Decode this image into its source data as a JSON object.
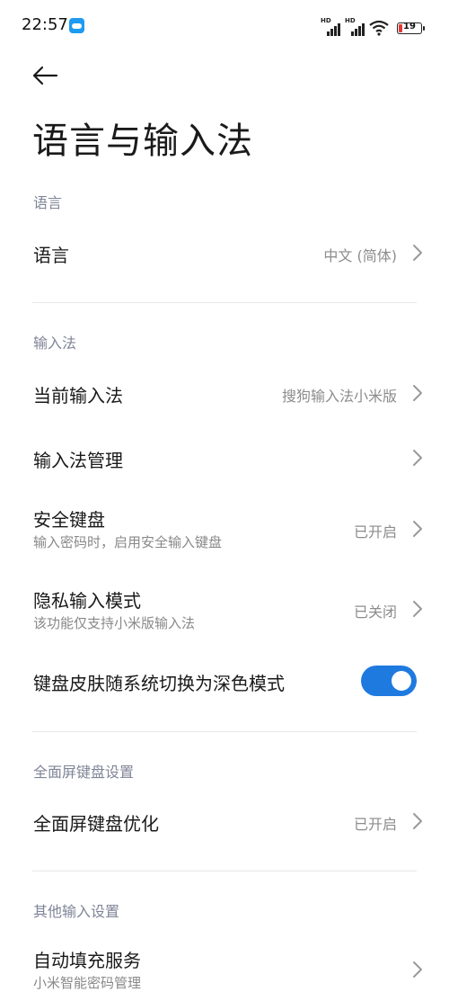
{
  "status_bar": {
    "time": "22:57",
    "app_icon": "cloud-app-icon",
    "signal_1_label": "HD",
    "signal_2_label": "HD",
    "battery_level": "19",
    "battery_color": "#e53935"
  },
  "header": {
    "back_icon": "arrow-left-icon",
    "title": "语言与输入法"
  },
  "sections": {
    "language": {
      "header": "语言",
      "items": [
        {
          "title": "语言",
          "value": "中文 (简体)"
        }
      ]
    },
    "input_method": {
      "header": "输入法",
      "items": [
        {
          "title": "当前输入法",
          "value": "搜狗输入法小米版"
        },
        {
          "title": "输入法管理",
          "value": ""
        },
        {
          "title": "安全键盘",
          "subtitle": "输入密码时，启用安全输入键盘",
          "value": "已开启"
        },
        {
          "title": "隐私输入模式",
          "subtitle": "该功能仅支持小米版输入法",
          "value": "已关闭"
        },
        {
          "title": "键盘皮肤随系统切换为深色模式",
          "toggle_on": true
        }
      ]
    },
    "fullscreen_keyboard": {
      "header": "全面屏键盘设置",
      "items": [
        {
          "title": "全面屏键盘优化",
          "value": "已开启"
        }
      ]
    },
    "other_input": {
      "header": "其他输入设置",
      "items": [
        {
          "title": "自动填充服务",
          "subtitle": "小米智能密码管理"
        }
      ]
    }
  },
  "colors": {
    "accent": "#1f7ae0",
    "section_header": "#7f8597",
    "secondary_text": "#8c8c8c"
  }
}
